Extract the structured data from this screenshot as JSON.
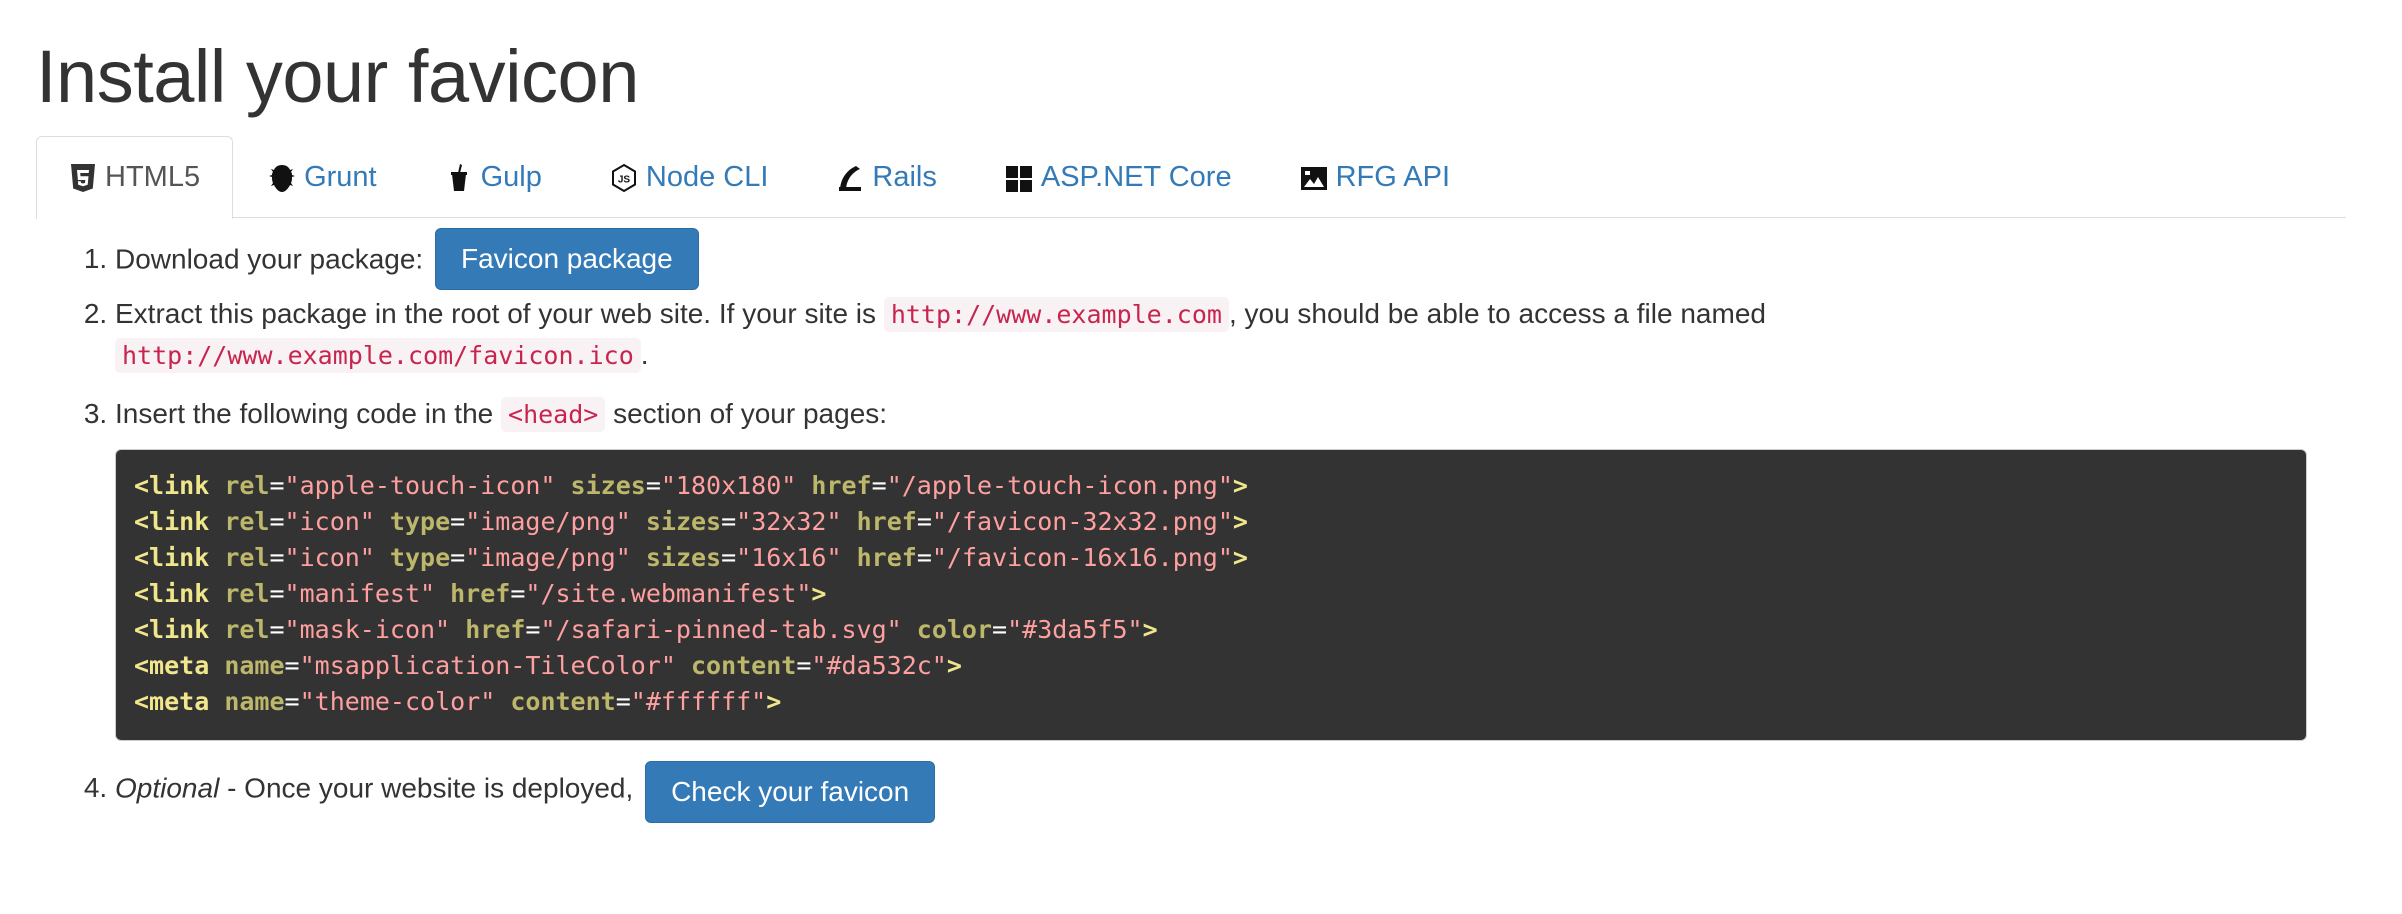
{
  "page": {
    "title": "Install your favicon"
  },
  "tabs": [
    {
      "label": "HTML5",
      "icon": "html5-icon",
      "active": true
    },
    {
      "label": "Grunt",
      "icon": "grunt-icon"
    },
    {
      "label": "Gulp",
      "icon": "gulp-icon"
    },
    {
      "label": "Node CLI",
      "icon": "nodejs-icon"
    },
    {
      "label": "Rails",
      "icon": "rails-icon"
    },
    {
      "label": "ASP.NET Core",
      "icon": "windows-icon"
    },
    {
      "label": "RFG API",
      "icon": "rfg-api-icon"
    }
  ],
  "steps": {
    "step1": {
      "text": "Download your package:",
      "button": "Favicon package"
    },
    "step2": {
      "text_before": "Extract this package in the root of your web site. If your site is",
      "code1": "http://www.example.com",
      "text_middle": ", you should be able to access a file named",
      "code2": "http://www.example.com/favicon.ico",
      "text_after": "."
    },
    "step3": {
      "text_before": "Insert the following code in the",
      "code": "<head>",
      "text_after": "section of your pages:"
    },
    "step4": {
      "optional": "Optional",
      "text": "- Once your website is deployed,",
      "button": "Check your favicon"
    }
  },
  "code_block": [
    {
      "tag": "link",
      "attrs": [
        [
          "rel",
          "apple-touch-icon"
        ],
        [
          "sizes",
          "180x180"
        ],
        [
          "href",
          "/apple-touch-icon.png"
        ]
      ]
    },
    {
      "tag": "link",
      "attrs": [
        [
          "rel",
          "icon"
        ],
        [
          "type",
          "image/png"
        ],
        [
          "sizes",
          "32x32"
        ],
        [
          "href",
          "/favicon-32x32.png"
        ]
      ]
    },
    {
      "tag": "link",
      "attrs": [
        [
          "rel",
          "icon"
        ],
        [
          "type",
          "image/png"
        ],
        [
          "sizes",
          "16x16"
        ],
        [
          "href",
          "/favicon-16x16.png"
        ]
      ]
    },
    {
      "tag": "link",
      "attrs": [
        [
          "rel",
          "manifest"
        ],
        [
          "href",
          "/site.webmanifest"
        ]
      ]
    },
    {
      "tag": "link",
      "attrs": [
        [
          "rel",
          "mask-icon"
        ],
        [
          "href",
          "/safari-pinned-tab.svg"
        ],
        [
          "color",
          "#3da5f5"
        ]
      ]
    },
    {
      "tag": "meta",
      "attrs": [
        [
          "name",
          "msapplication-TileColor"
        ],
        [
          "content",
          "#da532c"
        ]
      ]
    },
    {
      "tag": "meta",
      "attrs": [
        [
          "name",
          "theme-color"
        ],
        [
          "content",
          "#ffffff"
        ]
      ]
    }
  ],
  "colors": {
    "link": "#337ab7",
    "button_bg": "#337ab7",
    "code_text": "#c7254e",
    "code_bg": "#f9f2f4",
    "pre_bg": "#333333"
  }
}
